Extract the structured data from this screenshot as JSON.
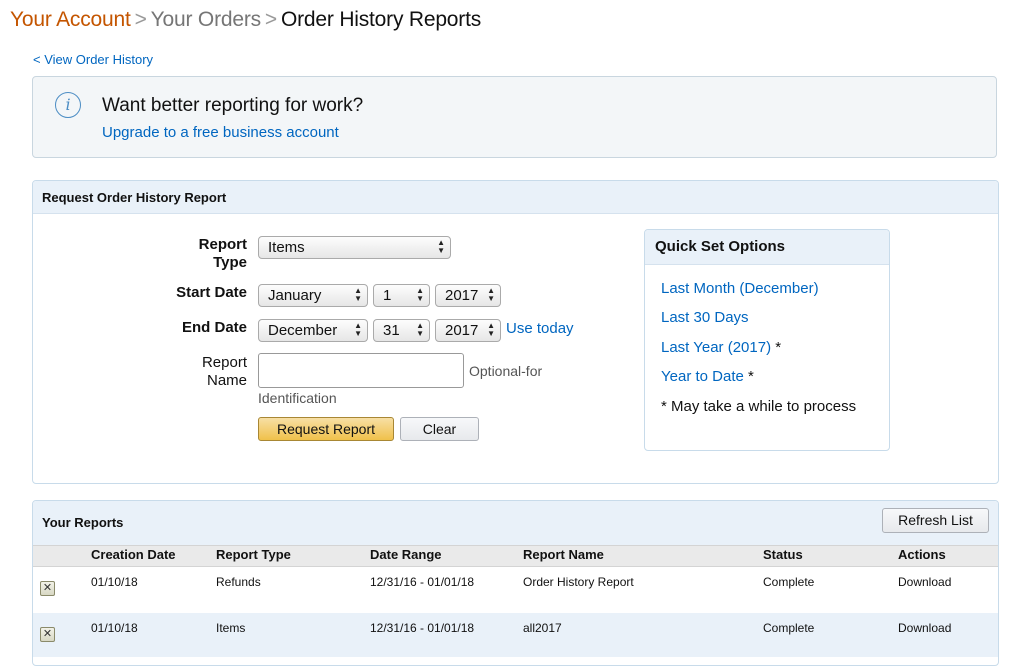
{
  "breadcrumb": {
    "items": [
      "Your Account",
      "Your Orders",
      "Order History Reports"
    ],
    "separator": ">"
  },
  "back_link": "< View Order History",
  "info": {
    "icon": "info-icon",
    "icon_glyph": "i",
    "heading": "Want better reporting for work?",
    "link": "Upgrade to a free business account"
  },
  "request_panel": {
    "title": "Request Order History Report",
    "report_type": {
      "label": "Report Type",
      "value": "Items"
    },
    "start_date": {
      "label": "Start Date",
      "month": "January",
      "day": "1",
      "year": "2017"
    },
    "end_date": {
      "label": "End Date",
      "month": "December",
      "day": "31",
      "year": "2017",
      "use_today": "Use today"
    },
    "report_name": {
      "label": "Report Name",
      "value": "",
      "hint_1": "Optional-for",
      "hint_2": "Identification"
    },
    "request_button": "Request Report",
    "clear_button": "Clear",
    "quick_set": {
      "title": "Quick Set Options",
      "items": [
        {
          "label": "Last Month (December)",
          "star": ""
        },
        {
          "label": "Last 30 Days",
          "star": ""
        },
        {
          "label": "Last Year (2017)",
          "star": "*"
        },
        {
          "label": "Year to Date",
          "star": "*"
        }
      ],
      "note": "* May take a while to process"
    }
  },
  "reports_panel": {
    "title": "Your Reports",
    "refresh_button": "Refresh List",
    "columns": [
      "Creation Date",
      "Report Type",
      "Date Range",
      "Report Name",
      "Status",
      "Actions"
    ],
    "rows": [
      {
        "creation_date": "01/10/18",
        "report_type": "Refunds",
        "date_range": "12/31/16 - 01/01/18",
        "report_name": "Order History Report",
        "status": "Complete",
        "action": "Download"
      },
      {
        "creation_date": "01/10/18",
        "report_type": "Items",
        "date_range": "12/31/16 - 01/01/18",
        "report_name": "all2017",
        "status": "Complete",
        "action": "Download"
      }
    ]
  },
  "colors": {
    "link": "#0066c0",
    "breadcrumb_active": "#c45500",
    "primary_button": "#f0c14b",
    "panel_header": "#e9f1f9"
  }
}
